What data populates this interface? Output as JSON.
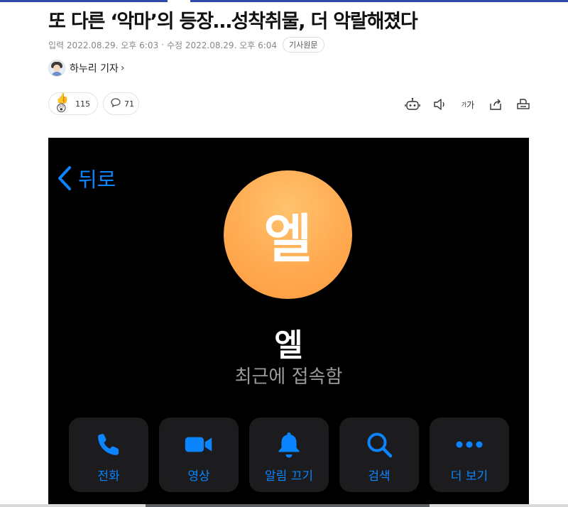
{
  "article": {
    "headline": "또 다른 ‘악마’의 등장…성착취물, 더 악랄해졌다",
    "input_label": "입력",
    "input_time": "2022.08.29. 오후 6:03",
    "edit_label": "수정",
    "edit_time": "2022.08.29. 오후 6:04",
    "separator": "·",
    "original_button": "기사원문",
    "author": "하누리 기자"
  },
  "engagement": {
    "reactions_count": "115",
    "comments_count": "71"
  },
  "tools": {
    "font_size_label_small": "가",
    "font_size_label_large": "가",
    "icons": [
      "robot-icon",
      "speaker-icon",
      "font-size-icon",
      "share-icon",
      "print-icon"
    ]
  },
  "embedded_screenshot": {
    "back_label": "뒤로",
    "avatar_initial": "엘",
    "contact_name": "엘",
    "status": "최근에 접속함",
    "actions": [
      {
        "label": "전화",
        "icon": "phone-icon"
      },
      {
        "label": "영상",
        "icon": "video-icon"
      },
      {
        "label": "알림 끄기",
        "icon": "bell-icon"
      },
      {
        "label": "검색",
        "icon": "search-icon"
      },
      {
        "label": "더 보기",
        "icon": "more-icon"
      }
    ],
    "colors": {
      "accent": "#0a84ff",
      "background": "#000000",
      "button_bg": "#1c1c1e",
      "avatar_orange": "#ffae56"
    }
  }
}
